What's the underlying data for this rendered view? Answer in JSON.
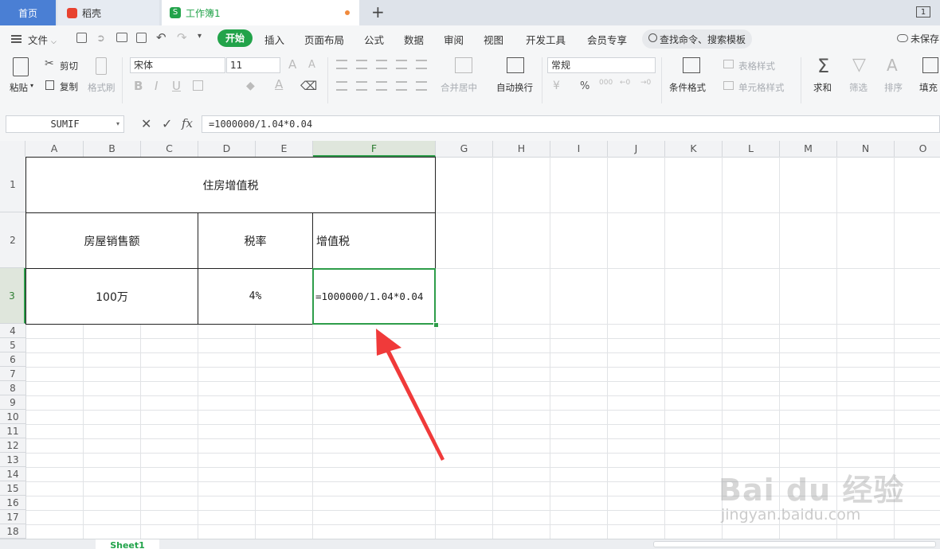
{
  "tabs": {
    "home": "首页",
    "daoke": "稻壳",
    "workbook": "工作簿1",
    "new_tab": "+",
    "window_badge": "1"
  },
  "menu": {
    "file": "文件",
    "items": [
      "开始",
      "插入",
      "页面布局",
      "公式",
      "数据",
      "审阅",
      "视图",
      "开发工具",
      "会员专享"
    ],
    "search": "查找命令、搜索模板",
    "unsaved": "未保存"
  },
  "ribbon": {
    "paste": "粘贴",
    "cut": "剪切",
    "copy": "复制",
    "format_painter": "格式刷",
    "font_name": "宋体",
    "font_size": "11",
    "merge_center": "合并居中",
    "wrap_text": "自动换行",
    "number_format": "常规",
    "percent": "%",
    "thousands": "000",
    "table_style": "表格样式",
    "cell_style": "单元格样式",
    "conditional_format": "条件格式",
    "sum": "求和",
    "filter": "筛选",
    "sort": "排序",
    "fill": "填充"
  },
  "formula_bar": {
    "name_box": "SUMIF",
    "fx": "fx",
    "formula": "=1000000/1.04*0.04"
  },
  "columns": [
    "A",
    "B",
    "C",
    "D",
    "E",
    "F",
    "G",
    "H",
    "I",
    "J",
    "K",
    "L",
    "M",
    "N",
    "O"
  ],
  "rows": [
    "1",
    "2",
    "3",
    "4",
    "5",
    "6",
    "7",
    "8",
    "9",
    "10",
    "11",
    "12",
    "13",
    "14",
    "15",
    "16",
    "17",
    "18"
  ],
  "cells": {
    "title": "住房增值税",
    "sales_header": "房屋销售额",
    "rate_header": "税率",
    "vat_header": "增值税",
    "sales_value": "100万",
    "rate_value": "4%",
    "vat_formula": "=1000000/1.04*0.04"
  },
  "sheet_tab": "Sheet1",
  "watermark": {
    "brand": "Bai du 经验",
    "url": "jingyan.baidu.com"
  },
  "colors": {
    "accent_green": "#22a34a",
    "selection_green": "#2e9d4a",
    "arrow_red": "#f03a3a",
    "home_tab_blue": "#4a7fd4"
  }
}
